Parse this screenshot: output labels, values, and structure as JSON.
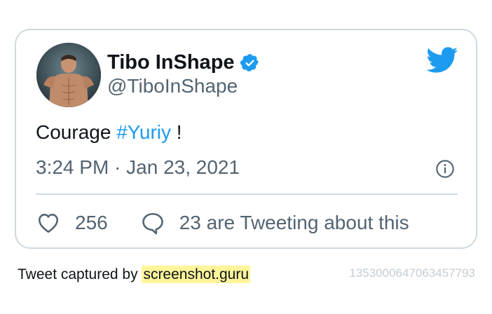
{
  "tweet": {
    "author_name": "Tibo InShape",
    "author_handle": "@TiboInShape",
    "text_plain": "Courage ",
    "hashtag": "#Yuriy",
    "text_after": " !",
    "timestamp": "3:24 PM · Jan 23, 2021",
    "likes": "256",
    "tweeting_text": "23 are Tweeting about this"
  },
  "footer": {
    "captured_prefix": "Tweet captured by ",
    "captured_link": "screenshot.guru",
    "tweet_id": "1353000647063457793"
  },
  "icons": {
    "verified": "verified-badge-icon",
    "bird": "twitter-bird-icon",
    "info": "info-icon",
    "heart": "heart-icon",
    "reply": "reply-icon"
  },
  "colors": {
    "accent": "#1d9bf0",
    "text": "#0f1419",
    "muted": "#536471",
    "border": "#cfd9de",
    "highlight": "#fff59a"
  }
}
